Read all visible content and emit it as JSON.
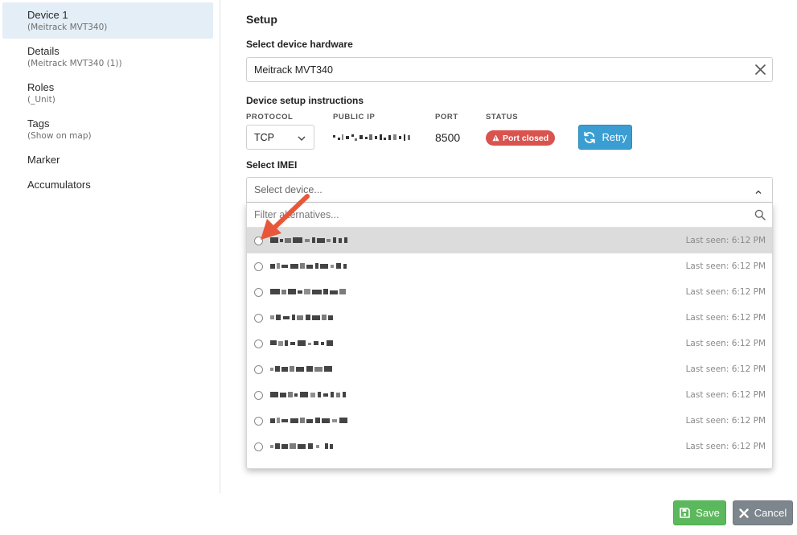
{
  "sidebar": {
    "items": [
      {
        "title": "Device 1",
        "sub": "(Meitrack MVT340)"
      },
      {
        "title": "Details",
        "sub": "(Meitrack MVT340 (1))"
      },
      {
        "title": "Roles",
        "sub": "(_Unit)"
      },
      {
        "title": "Tags",
        "sub": "(Show on map)"
      },
      {
        "title": "Marker"
      },
      {
        "title": "Accumulators"
      }
    ]
  },
  "setup": {
    "title": "Setup",
    "hardware_label": "Select device hardware",
    "hardware_value": "Meitrack MVT340",
    "instructions_label": "Device setup instructions",
    "columns": {
      "protocol": "PROTOCOL",
      "public_ip": "PUBLIC IP",
      "port": "PORT",
      "status": "STATUS"
    },
    "protocol_value": "TCP",
    "port_value": "8500",
    "status_value": "Port closed",
    "status_color": "#d9534f",
    "retry_label": "Retry",
    "imei_label": "Select IMEI",
    "imei_placeholder": "Select device...",
    "filter_placeholder": "Filter alternatives...",
    "options": [
      {
        "last_seen": "Last seen: 6:12 PM"
      },
      {
        "last_seen": "Last seen: 6:12 PM"
      },
      {
        "last_seen": "Last seen: 6:12 PM"
      },
      {
        "last_seen": "Last seen: 6:12 PM"
      },
      {
        "last_seen": "Last seen: 6:12 PM"
      },
      {
        "last_seen": "Last seen: 6:12 PM"
      },
      {
        "last_seen": "Last seen: 6:12 PM"
      },
      {
        "last_seen": "Last seen: 6:12 PM"
      },
      {
        "last_seen": "Last seen: 6:12 PM"
      }
    ]
  },
  "footer": {
    "save_label": "Save",
    "cancel_label": "Cancel",
    "save_color": "#5cb85c",
    "cancel_color": "#7d858d"
  },
  "accent": "#3b9ed2"
}
